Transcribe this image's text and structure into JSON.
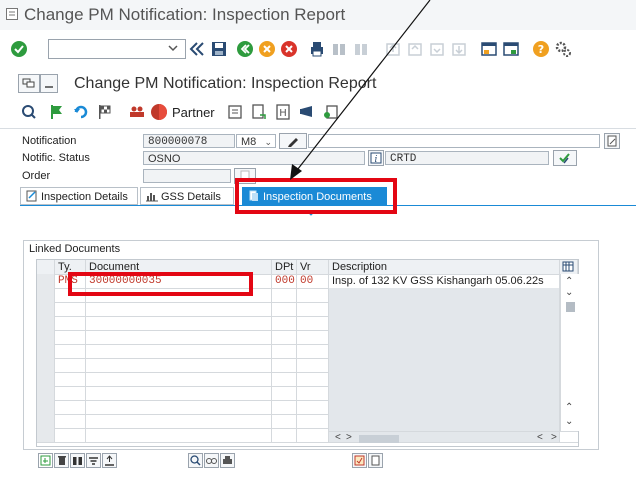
{
  "window": {
    "title": "Change PM Notification: Inspection Report"
  },
  "header": {
    "title": "Change PM Notification: Inspection Report"
  },
  "toolbar": {
    "partner_label": "Partner"
  },
  "form": {
    "notification_label": "Notification",
    "notification_value": "800000078",
    "notification_type": "M8",
    "status_label": "Notific. Status",
    "status_value": "OSNO",
    "status_text": "CRTD",
    "order_label": "Order"
  },
  "tabs": [
    {
      "label": "Inspection Details"
    },
    {
      "label": "GSS Details"
    },
    {
      "label": "Inspection Documents"
    }
  ],
  "linked": {
    "title": "Linked Documents",
    "columns": [
      "Ty.",
      "Document",
      "DPt",
      "Vr",
      "Description"
    ],
    "rows": [
      {
        "type": "PMS",
        "document": "30000000035",
        "dpt": "000",
        "vr": "00",
        "description": "Insp. of 132 KV GSS Kishangarh 05.06.22s"
      }
    ]
  },
  "colors": {
    "accent": "#1a8ad6",
    "highlight": "#e30613",
    "doc_text": "#c0392b"
  }
}
